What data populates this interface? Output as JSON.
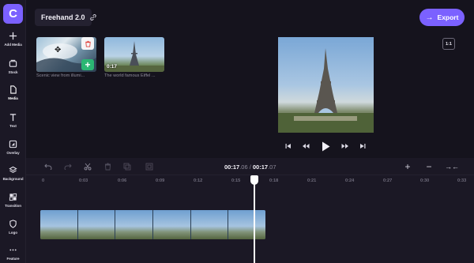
{
  "app": {
    "logo_letter": "C",
    "accent": "#7b61ff"
  },
  "sidebar": {
    "items": [
      {
        "label": "Add Media",
        "icon": "plus-icon"
      },
      {
        "label": "Stock",
        "icon": "stock-icon"
      },
      {
        "label": "Media",
        "icon": "file-icon"
      },
      {
        "label": "Text",
        "icon": "text-icon"
      },
      {
        "label": "Overlay",
        "icon": "overlay-icon"
      },
      {
        "label": "Background",
        "icon": "layers-icon"
      },
      {
        "label": "Transition",
        "icon": "transition-icon"
      },
      {
        "label": "Logo",
        "icon": "shield-icon"
      },
      {
        "label": "Feature",
        "icon": "more-icon"
      }
    ]
  },
  "header": {
    "project_name": "Freehand 2.0",
    "export_label": "Export"
  },
  "media": {
    "items": [
      {
        "caption": "Scenic view from illumi...",
        "badge": ""
      },
      {
        "caption": "The world famous Eiffel ...",
        "badge": "0:17"
      }
    ]
  },
  "preview": {
    "aspect_ratio": "1:1"
  },
  "timeline": {
    "current_time_main": "00:17",
    "current_time_frac": ".06",
    "separator": " / ",
    "total_time_main": "00:17",
    "total_time_frac": ".07",
    "ruler_ticks": [
      "0",
      "0:03",
      "0:06",
      "0:09",
      "0:12",
      "0:15",
      "0:18",
      "0:21",
      "0:24",
      "0:27",
      "0:30",
      "0:33"
    ]
  }
}
